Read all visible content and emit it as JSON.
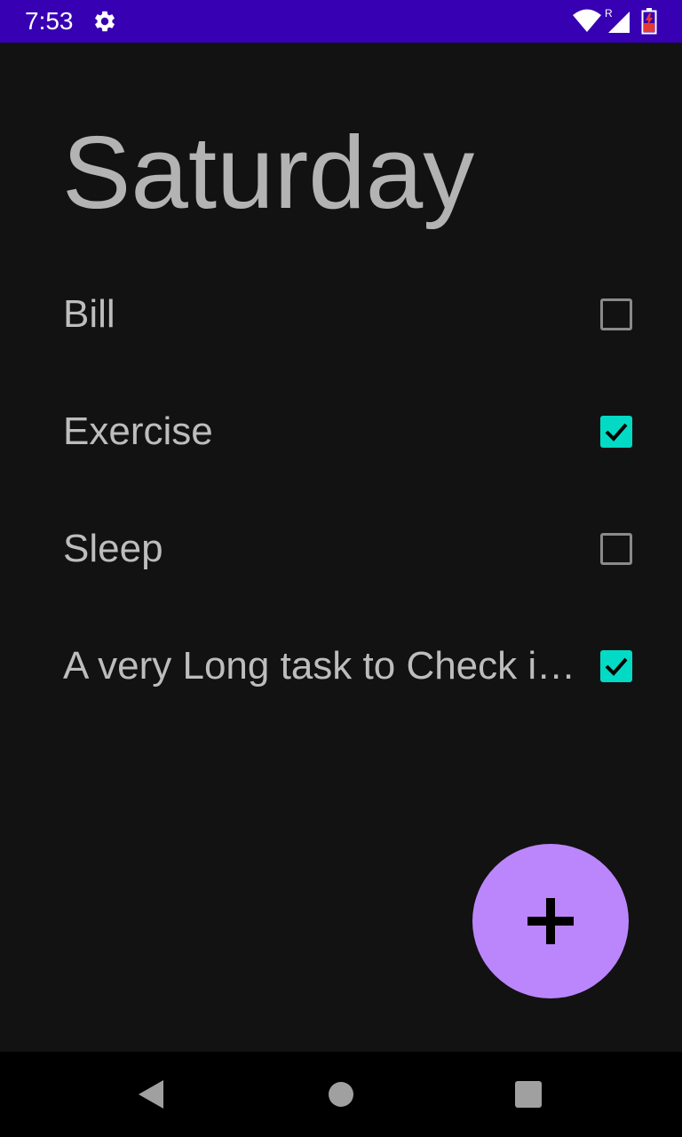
{
  "status_bar": {
    "time": "7:53",
    "roaming_indicator": "R",
    "icons": [
      "gear-icon",
      "wifi-icon",
      "signal-icon",
      "battery-icon"
    ],
    "background_color": "#3700b3"
  },
  "main": {
    "title": "Saturday",
    "tasks": [
      {
        "label": "Bill",
        "checked": false
      },
      {
        "label": "Exercise",
        "checked": true
      },
      {
        "label": "Sleep",
        "checked": false
      },
      {
        "label": "A very Long task to Check in time for something",
        "checked": true
      }
    ],
    "accent_color": "#03dac5"
  },
  "fab": {
    "icon": "plus-icon",
    "color": "#bb86fc"
  },
  "nav_bar": {
    "icons": [
      "back-icon",
      "home-icon",
      "recents-icon"
    ]
  }
}
